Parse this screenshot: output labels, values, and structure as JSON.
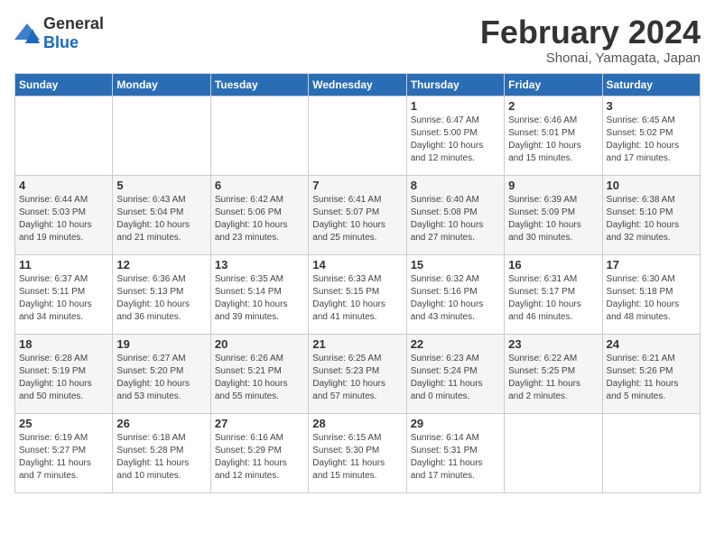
{
  "logo": {
    "general": "General",
    "blue": "Blue"
  },
  "title": "February 2024",
  "subtitle": "Shonai, Yamagata, Japan",
  "days_of_week": [
    "Sunday",
    "Monday",
    "Tuesday",
    "Wednesday",
    "Thursday",
    "Friday",
    "Saturday"
  ],
  "weeks": [
    [
      {
        "day": "",
        "content": ""
      },
      {
        "day": "",
        "content": ""
      },
      {
        "day": "",
        "content": ""
      },
      {
        "day": "",
        "content": ""
      },
      {
        "day": "1",
        "content": "Sunrise: 6:47 AM\nSunset: 5:00 PM\nDaylight: 10 hours\nand 12 minutes."
      },
      {
        "day": "2",
        "content": "Sunrise: 6:46 AM\nSunset: 5:01 PM\nDaylight: 10 hours\nand 15 minutes."
      },
      {
        "day": "3",
        "content": "Sunrise: 6:45 AM\nSunset: 5:02 PM\nDaylight: 10 hours\nand 17 minutes."
      }
    ],
    [
      {
        "day": "4",
        "content": "Sunrise: 6:44 AM\nSunset: 5:03 PM\nDaylight: 10 hours\nand 19 minutes."
      },
      {
        "day": "5",
        "content": "Sunrise: 6:43 AM\nSunset: 5:04 PM\nDaylight: 10 hours\nand 21 minutes."
      },
      {
        "day": "6",
        "content": "Sunrise: 6:42 AM\nSunset: 5:06 PM\nDaylight: 10 hours\nand 23 minutes."
      },
      {
        "day": "7",
        "content": "Sunrise: 6:41 AM\nSunset: 5:07 PM\nDaylight: 10 hours\nand 25 minutes."
      },
      {
        "day": "8",
        "content": "Sunrise: 6:40 AM\nSunset: 5:08 PM\nDaylight: 10 hours\nand 27 minutes."
      },
      {
        "day": "9",
        "content": "Sunrise: 6:39 AM\nSunset: 5:09 PM\nDaylight: 10 hours\nand 30 minutes."
      },
      {
        "day": "10",
        "content": "Sunrise: 6:38 AM\nSunset: 5:10 PM\nDaylight: 10 hours\nand 32 minutes."
      }
    ],
    [
      {
        "day": "11",
        "content": "Sunrise: 6:37 AM\nSunset: 5:11 PM\nDaylight: 10 hours\nand 34 minutes."
      },
      {
        "day": "12",
        "content": "Sunrise: 6:36 AM\nSunset: 5:13 PM\nDaylight: 10 hours\nand 36 minutes."
      },
      {
        "day": "13",
        "content": "Sunrise: 6:35 AM\nSunset: 5:14 PM\nDaylight: 10 hours\nand 39 minutes."
      },
      {
        "day": "14",
        "content": "Sunrise: 6:33 AM\nSunset: 5:15 PM\nDaylight: 10 hours\nand 41 minutes."
      },
      {
        "day": "15",
        "content": "Sunrise: 6:32 AM\nSunset: 5:16 PM\nDaylight: 10 hours\nand 43 minutes."
      },
      {
        "day": "16",
        "content": "Sunrise: 6:31 AM\nSunset: 5:17 PM\nDaylight: 10 hours\nand 46 minutes."
      },
      {
        "day": "17",
        "content": "Sunrise: 6:30 AM\nSunset: 5:18 PM\nDaylight: 10 hours\nand 48 minutes."
      }
    ],
    [
      {
        "day": "18",
        "content": "Sunrise: 6:28 AM\nSunset: 5:19 PM\nDaylight: 10 hours\nand 50 minutes."
      },
      {
        "day": "19",
        "content": "Sunrise: 6:27 AM\nSunset: 5:20 PM\nDaylight: 10 hours\nand 53 minutes."
      },
      {
        "day": "20",
        "content": "Sunrise: 6:26 AM\nSunset: 5:21 PM\nDaylight: 10 hours\nand 55 minutes."
      },
      {
        "day": "21",
        "content": "Sunrise: 6:25 AM\nSunset: 5:23 PM\nDaylight: 10 hours\nand 57 minutes."
      },
      {
        "day": "22",
        "content": "Sunrise: 6:23 AM\nSunset: 5:24 PM\nDaylight: 11 hours\nand 0 minutes."
      },
      {
        "day": "23",
        "content": "Sunrise: 6:22 AM\nSunset: 5:25 PM\nDaylight: 11 hours\nand 2 minutes."
      },
      {
        "day": "24",
        "content": "Sunrise: 6:21 AM\nSunset: 5:26 PM\nDaylight: 11 hours\nand 5 minutes."
      }
    ],
    [
      {
        "day": "25",
        "content": "Sunrise: 6:19 AM\nSunset: 5:27 PM\nDaylight: 11 hours\nand 7 minutes."
      },
      {
        "day": "26",
        "content": "Sunrise: 6:18 AM\nSunset: 5:28 PM\nDaylight: 11 hours\nand 10 minutes."
      },
      {
        "day": "27",
        "content": "Sunrise: 6:16 AM\nSunset: 5:29 PM\nDaylight: 11 hours\nand 12 minutes."
      },
      {
        "day": "28",
        "content": "Sunrise: 6:15 AM\nSunset: 5:30 PM\nDaylight: 11 hours\nand 15 minutes."
      },
      {
        "day": "29",
        "content": "Sunrise: 6:14 AM\nSunset: 5:31 PM\nDaylight: 11 hours\nand 17 minutes."
      },
      {
        "day": "",
        "content": ""
      },
      {
        "day": "",
        "content": ""
      }
    ]
  ]
}
